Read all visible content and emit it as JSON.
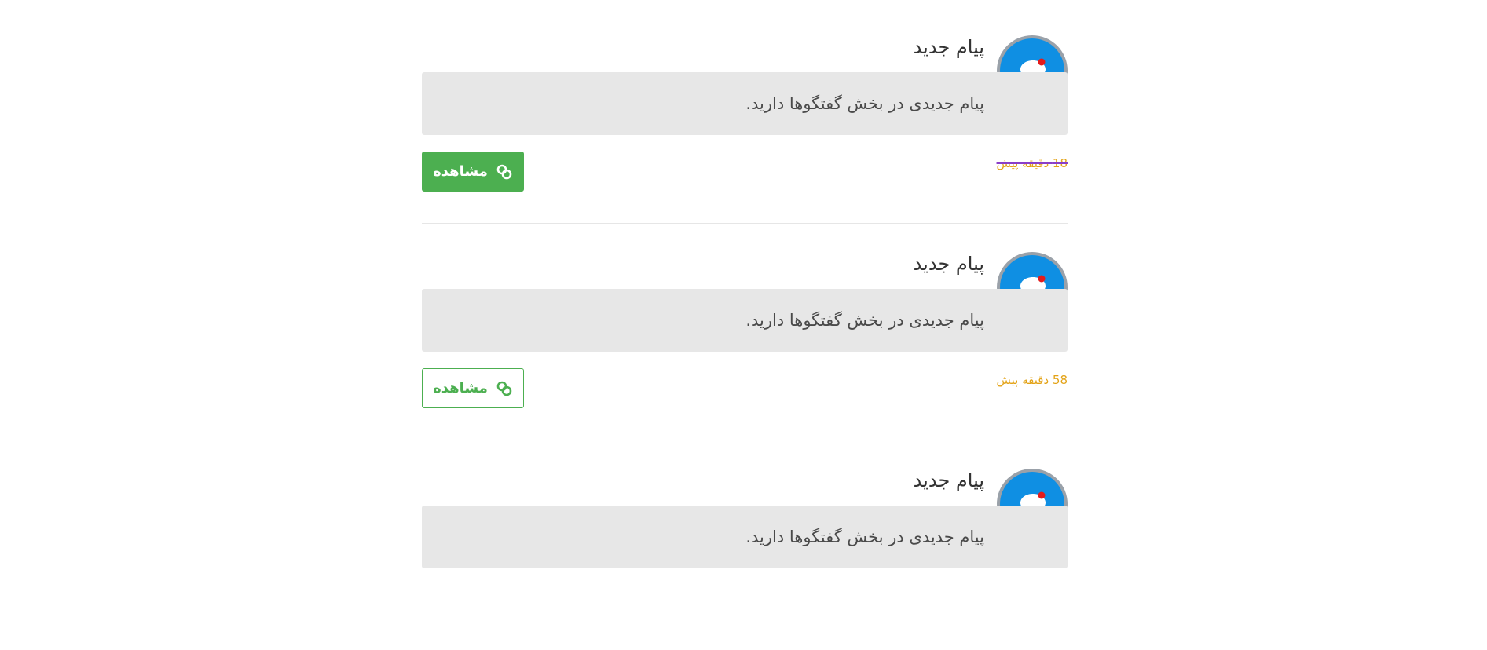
{
  "colors": {
    "avatar_ring": "#9aa1a9",
    "avatar_fill": "#0f8fe3",
    "unread_dot": "#e41b1b",
    "time_text": "#e3a317",
    "button_green": "#4caf50",
    "body_box": "#e7e7e7"
  },
  "notifications": [
    {
      "icon": "chat-bubble-icon",
      "title": "پیام جدید",
      "body": "پیام جدیدی در بخش گفتگوها دارید.",
      "time": "18 دقیقه پیش",
      "action_label": "مشاهده",
      "action_icon": "link-icon"
    },
    {
      "icon": "chat-bubble-icon",
      "title": "پیام جدید",
      "body": "پیام جدیدی در بخش گفتگوها دارید.",
      "time": "58 دقیقه پیش",
      "action_label": "مشاهده",
      "action_icon": "link-icon"
    },
    {
      "icon": "chat-bubble-icon",
      "title": "پیام جدید",
      "body": "پیام جدیدی در بخش گفتگوها دارید."
    }
  ]
}
